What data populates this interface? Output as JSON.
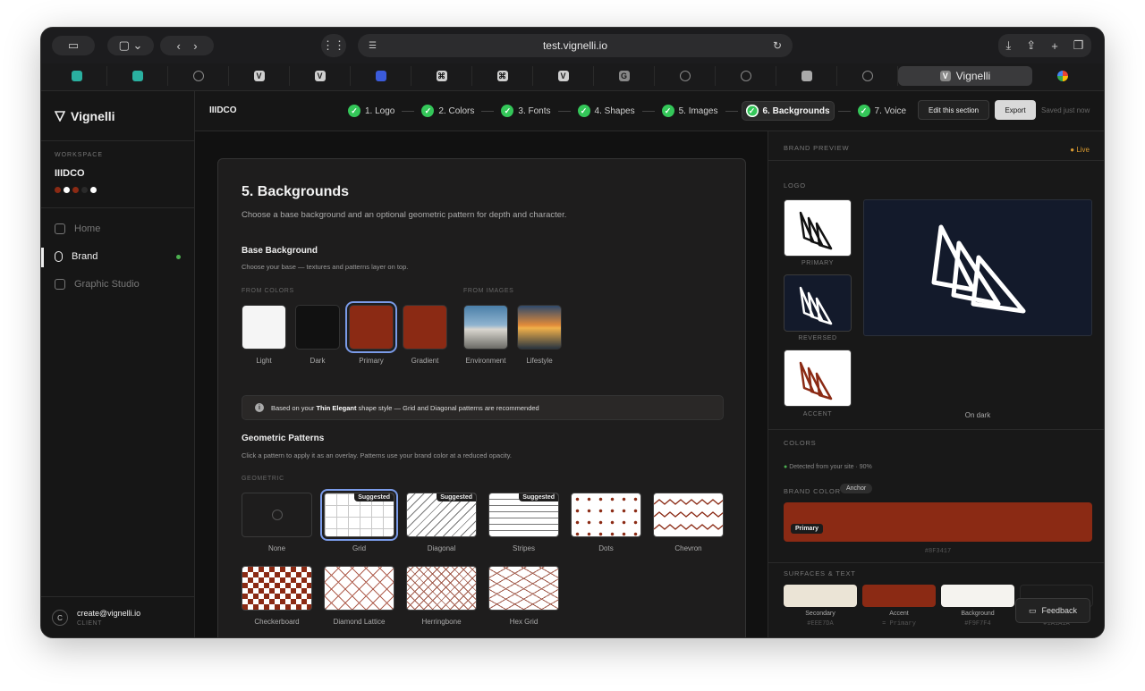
{
  "browser": {
    "url": "test.vignelli.io",
    "active_tab_title": "Vignelli",
    "active_tab_icon": "V"
  },
  "sidebar": {
    "app_name": "Vignelli",
    "workspace_label": "WORKSPACE",
    "workspace_name": "IIIDCO",
    "palette": [
      "#8b2a14",
      "#ffffff",
      "#8b2a14",
      "#2a2a2a",
      "#ffffff"
    ],
    "nav": [
      {
        "label": "Home",
        "icon": "home-icon"
      },
      {
        "label": "Brand",
        "icon": "brand-icon"
      },
      {
        "label": "Graphic Studio",
        "icon": "image-icon"
      }
    ],
    "user": {
      "initial": "C",
      "email": "create@vignelli.io",
      "role": "CLIENT"
    }
  },
  "topbar": {
    "brand_code": "IIIDCO",
    "steps": [
      "1. Logo",
      "2. Colors",
      "3. Fonts",
      "4. Shapes",
      "5. Images",
      "6. Backgrounds",
      "7. Voice"
    ],
    "edit_label": "Edit this section",
    "export_label": "Export",
    "saved_label": "Saved just now"
  },
  "main": {
    "title": "5. Backgrounds",
    "subtitle": "Choose a base background and an optional geometric pattern for depth and character.",
    "base": {
      "heading": "Base Background",
      "hint": "Choose your base — textures and patterns layer on top.",
      "from_colors_label": "FROM COLORS",
      "from_images_label": "FROM IMAGES",
      "swatches": [
        {
          "label": "Light",
          "color": "#f5f5f5"
        },
        {
          "label": "Dark",
          "color": "#111111"
        },
        {
          "label": "Primary",
          "color": "#8b2a14"
        },
        {
          "label": "Gradient",
          "color": "#8b2a14"
        }
      ],
      "images": [
        "Environment",
        "Lifestyle"
      ]
    },
    "notice": {
      "prefix": "Based on your ",
      "highlight": "Thin Elegant",
      "suffix": " shape style — Grid and Diagonal patterns are recommended"
    },
    "patterns": {
      "heading": "Geometric Patterns",
      "hint": "Click a pattern to apply it as an overlay. Patterns use your brand color at a reduced opacity.",
      "group_label": "GEOMETRIC",
      "suggested_label": "Suggested",
      "items": [
        "None",
        "Grid",
        "Diagonal",
        "Stripes",
        "Dots",
        "Chevron",
        "Checkerboard",
        "Diamond Lattice",
        "Herringbone",
        "Hex Grid"
      ]
    }
  },
  "preview": {
    "header": "BRAND PREVIEW",
    "live": "Live",
    "logo_label": "LOGO",
    "logo_variants": [
      "PRIMARY",
      "REVERSED",
      "ACCENT"
    ],
    "on_dark": "On dark",
    "colors_label": "COLORS",
    "detected": "Detected from your site · 90%",
    "brand_color_label": "BRAND COLOR",
    "anchor": "Anchor",
    "primary_label": "Primary",
    "primary_hex": "#8F3417",
    "surfaces_label": "SURFACES & TEXT",
    "surfaces": [
      {
        "name": "Secondary",
        "value": "#EEE7DA",
        "color": "#ebe4d6"
      },
      {
        "name": "Accent",
        "value": "= Primary",
        "color": "#8b2a14"
      },
      {
        "name": "Background",
        "value": "#F9F7F4",
        "color": "#f5f3ef"
      },
      {
        "name": "",
        "value": "#1A1A1A",
        "color": "#1a1a1a"
      }
    ]
  },
  "feedback_label": "Feedback"
}
